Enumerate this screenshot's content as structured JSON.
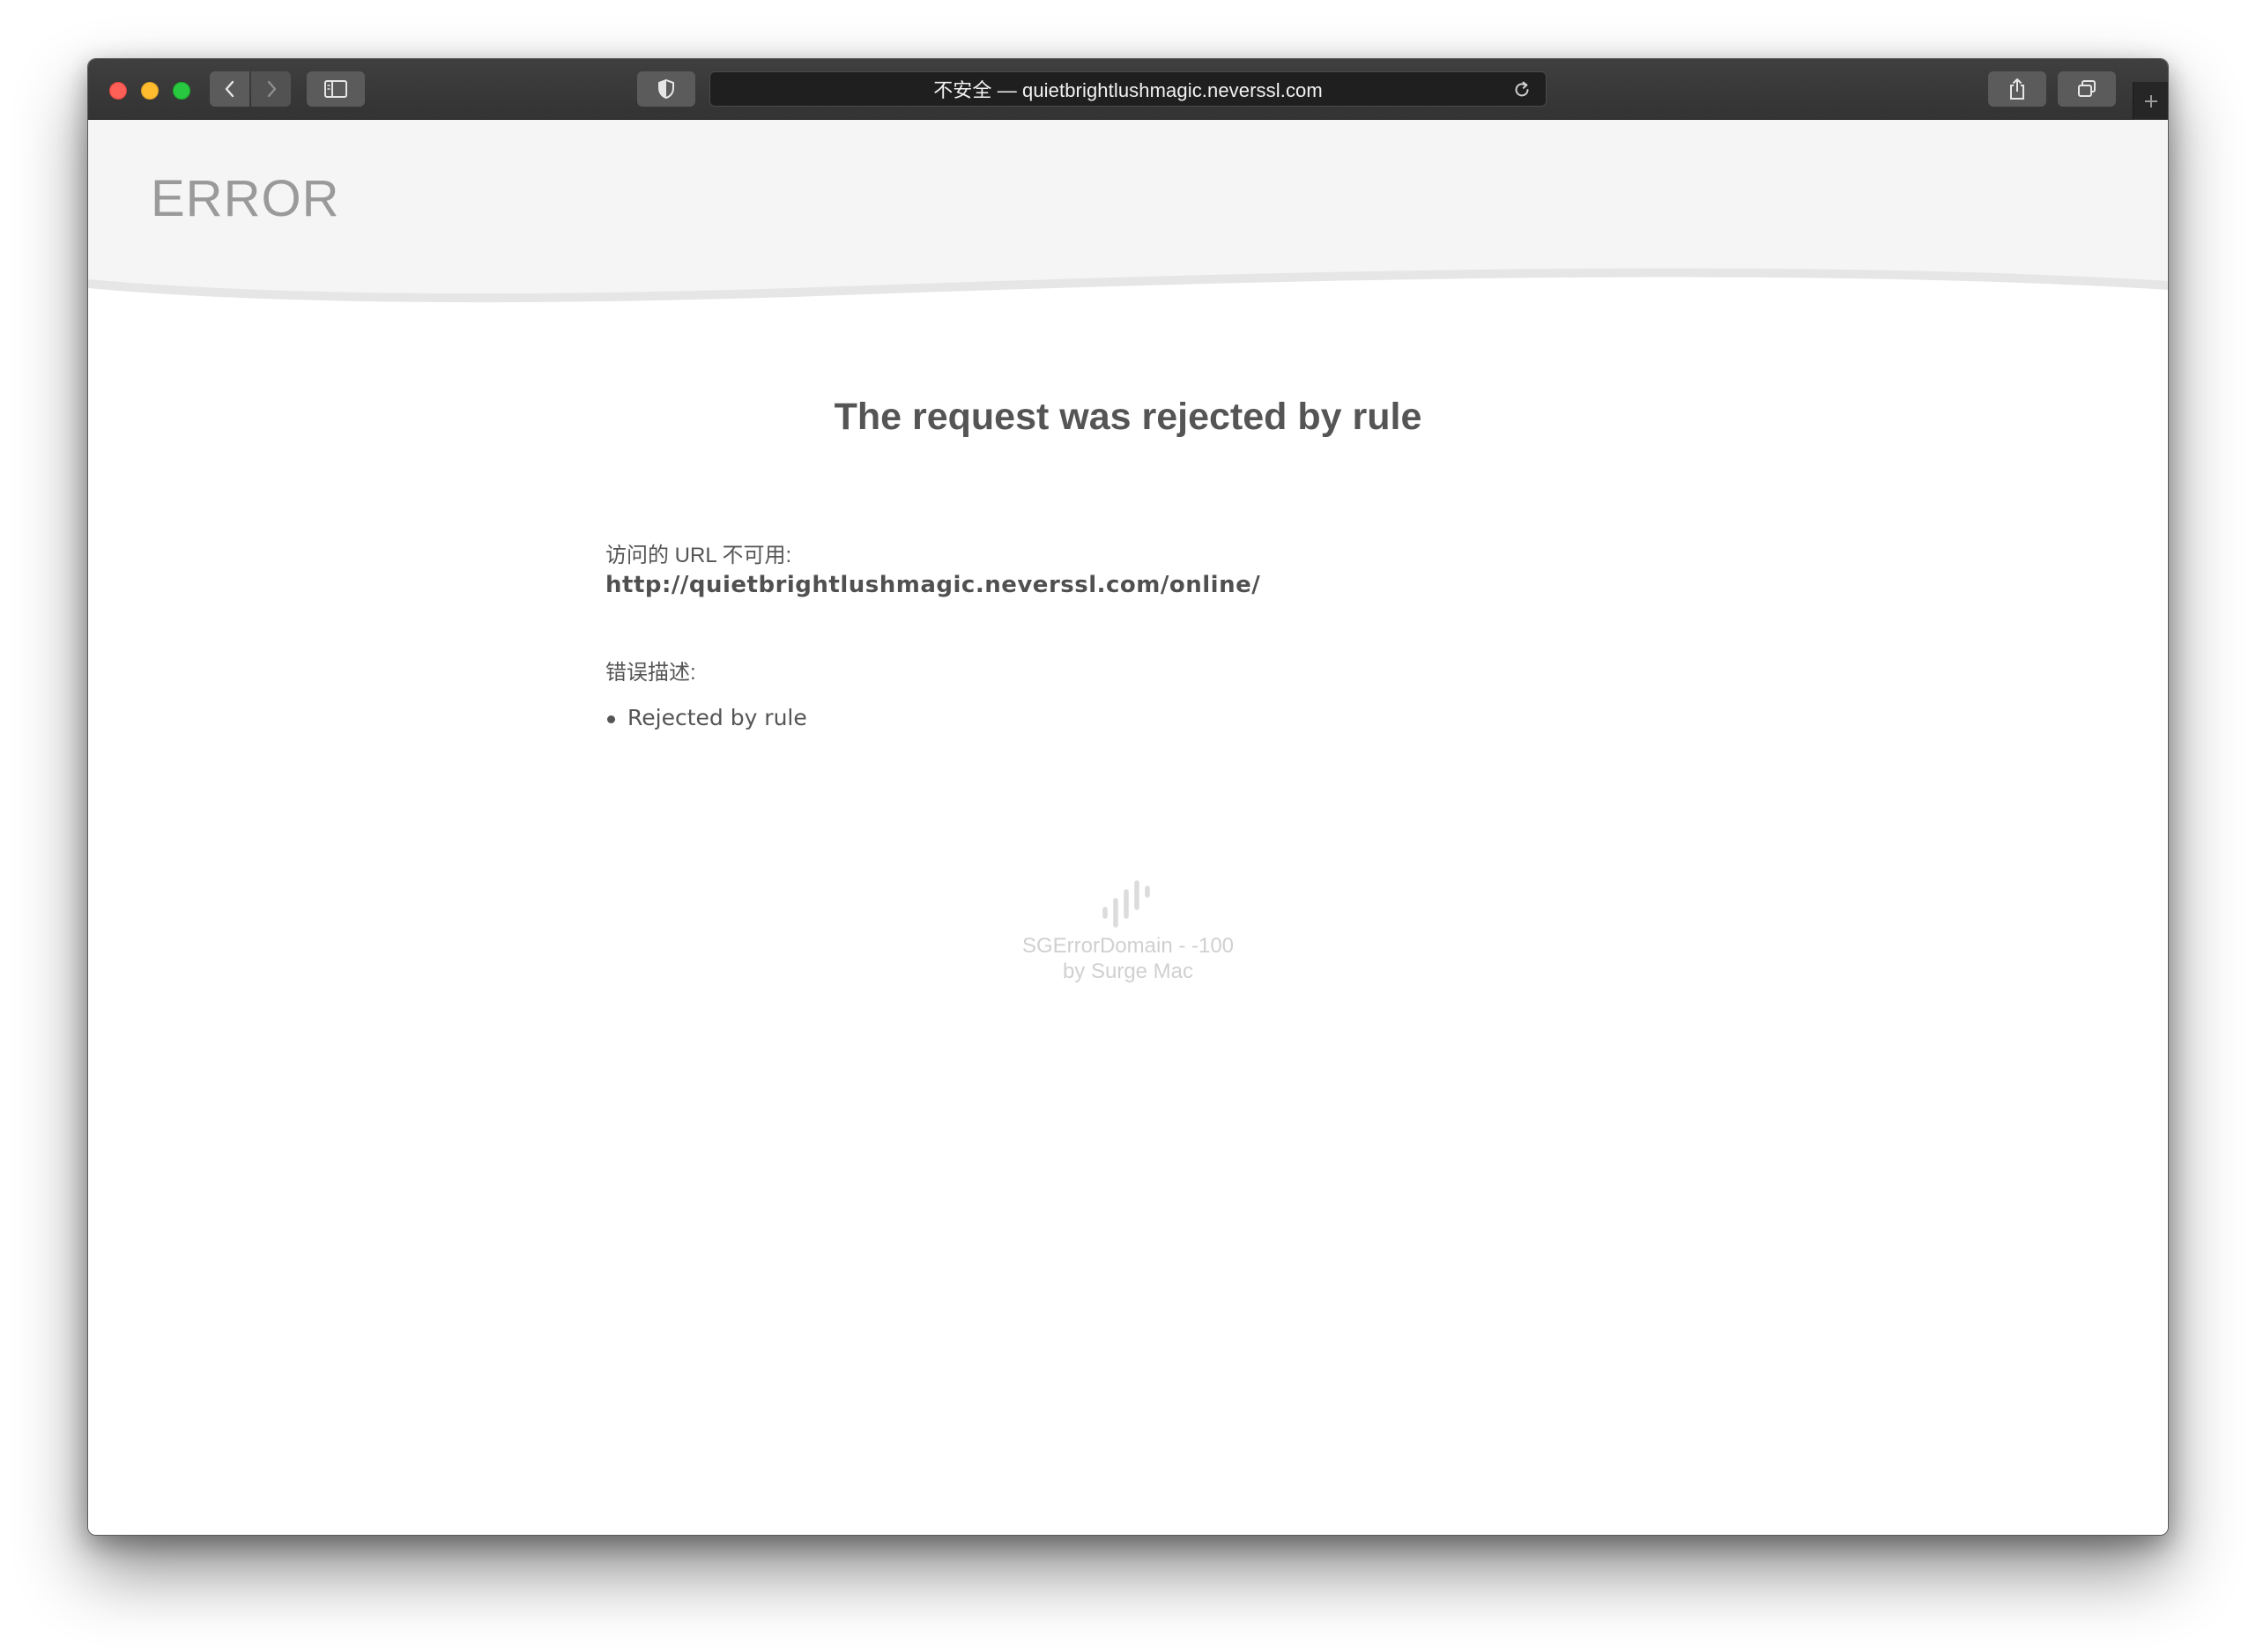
{
  "browser": {
    "address_text": "不安全 — quietbrightlushmagic.neverssl.com",
    "icons": {
      "back": "chevron-left-icon",
      "forward": "chevron-right-icon",
      "sidebar": "sidebar-icon",
      "privacy": "shield-icon",
      "reload": "reload-icon",
      "share": "share-icon",
      "tabs": "tabs-overview-icon",
      "new_tab": "plus-icon"
    }
  },
  "page": {
    "header_title": "ERROR",
    "heading": "The request was rejected by rule",
    "url_label": "访问的 URL 不可用:",
    "url_value": "http://quietbrightlushmagic.neverssl.com/online/",
    "description_label": "错误描述:",
    "descriptions": [
      "Rejected by rule"
    ],
    "footer": {
      "domain_line": "SGErrorDomain - -100",
      "by_line": "by Surge Mac"
    }
  },
  "colors": {
    "logo_gradient_start": "#4a90ff",
    "logo_gradient_end": "#b45cf0",
    "header_background": "#f5f5f5",
    "text": "#555555"
  }
}
